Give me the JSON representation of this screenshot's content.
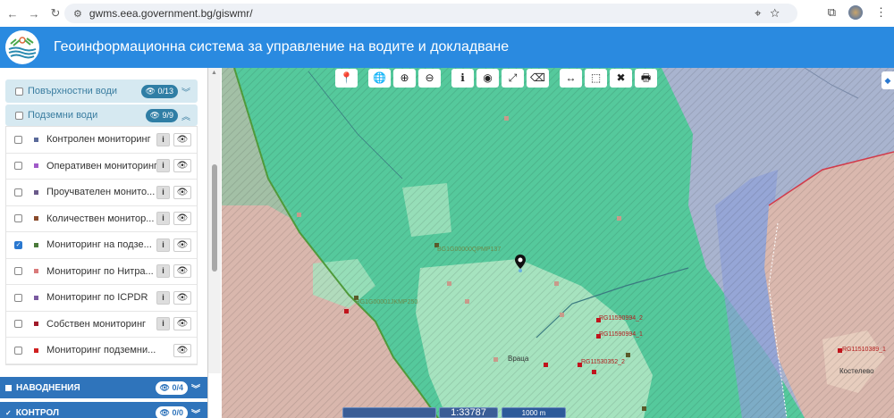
{
  "browser": {
    "url": "gwms.eea.government.bg/giswmr/"
  },
  "header": {
    "title": "Геоинформационна система за управление на водите и докладване"
  },
  "sidebar": {
    "groups": [
      {
        "label": "Повърхностни води",
        "badge": "0/13",
        "checked": false
      },
      {
        "label": "Подземни води",
        "badge": "9/9",
        "checked": false
      }
    ],
    "items": [
      {
        "label": "Контролен мониторинг",
        "color": "#5a6a9a",
        "checked": false,
        "info": true
      },
      {
        "label": "Оперативен мониторинг",
        "color": "#a05ac8",
        "checked": false,
        "info": true
      },
      {
        "label": "Проучвателен монито...",
        "color": "#6a5a8a",
        "checked": false,
        "info": true
      },
      {
        "label": "Количествен монитор...",
        "color": "#8a4a2a",
        "checked": false,
        "info": true
      },
      {
        "label": "Мониторинг на подзе...",
        "color": "#4a7a3a",
        "checked": true,
        "info": true
      },
      {
        "label": "Мониторинг по Нитра...",
        "color": "#d97a7a",
        "checked": false,
        "info": true
      },
      {
        "label": "Мониторинг по ICPDR",
        "color": "#7a5aa0",
        "checked": false,
        "info": true
      },
      {
        "label": "Собствен мониторинг",
        "color": "#a01a2a",
        "checked": false,
        "info": true
      },
      {
        "label": "Мониторинг подземни...",
        "color": "#d02020",
        "checked": false,
        "info": false
      }
    ],
    "sections": [
      {
        "label": "НАВОДНЕНИЯ",
        "badge": "0/4"
      },
      {
        "label": "КОНТРОЛ",
        "badge": "0/0"
      }
    ]
  },
  "map": {
    "scale": "1:33787",
    "scalebar": "1000 m",
    "labels": [
      {
        "text": "BG1G00000QPMP137",
        "kind": "station-green"
      },
      {
        "text": "BG1G00001JKMP250",
        "kind": "station-green"
      },
      {
        "text": "RG11590994_2",
        "kind": "station-red"
      },
      {
        "text": "RG11590994_1",
        "kind": "station-red"
      },
      {
        "text": "RG11530352_2",
        "kind": "station-red"
      },
      {
        "text": "RG11510389_1",
        "kind": "station-red"
      }
    ],
    "towns": [
      "Враца",
      "Костелево"
    ]
  },
  "toolbar": [
    "map-marker",
    "globe",
    "zoom-in",
    "zoom-out",
    "info",
    "locate",
    "fullscreen",
    "eraser",
    "measure-distance",
    "measure-area",
    "clear",
    "print"
  ]
}
